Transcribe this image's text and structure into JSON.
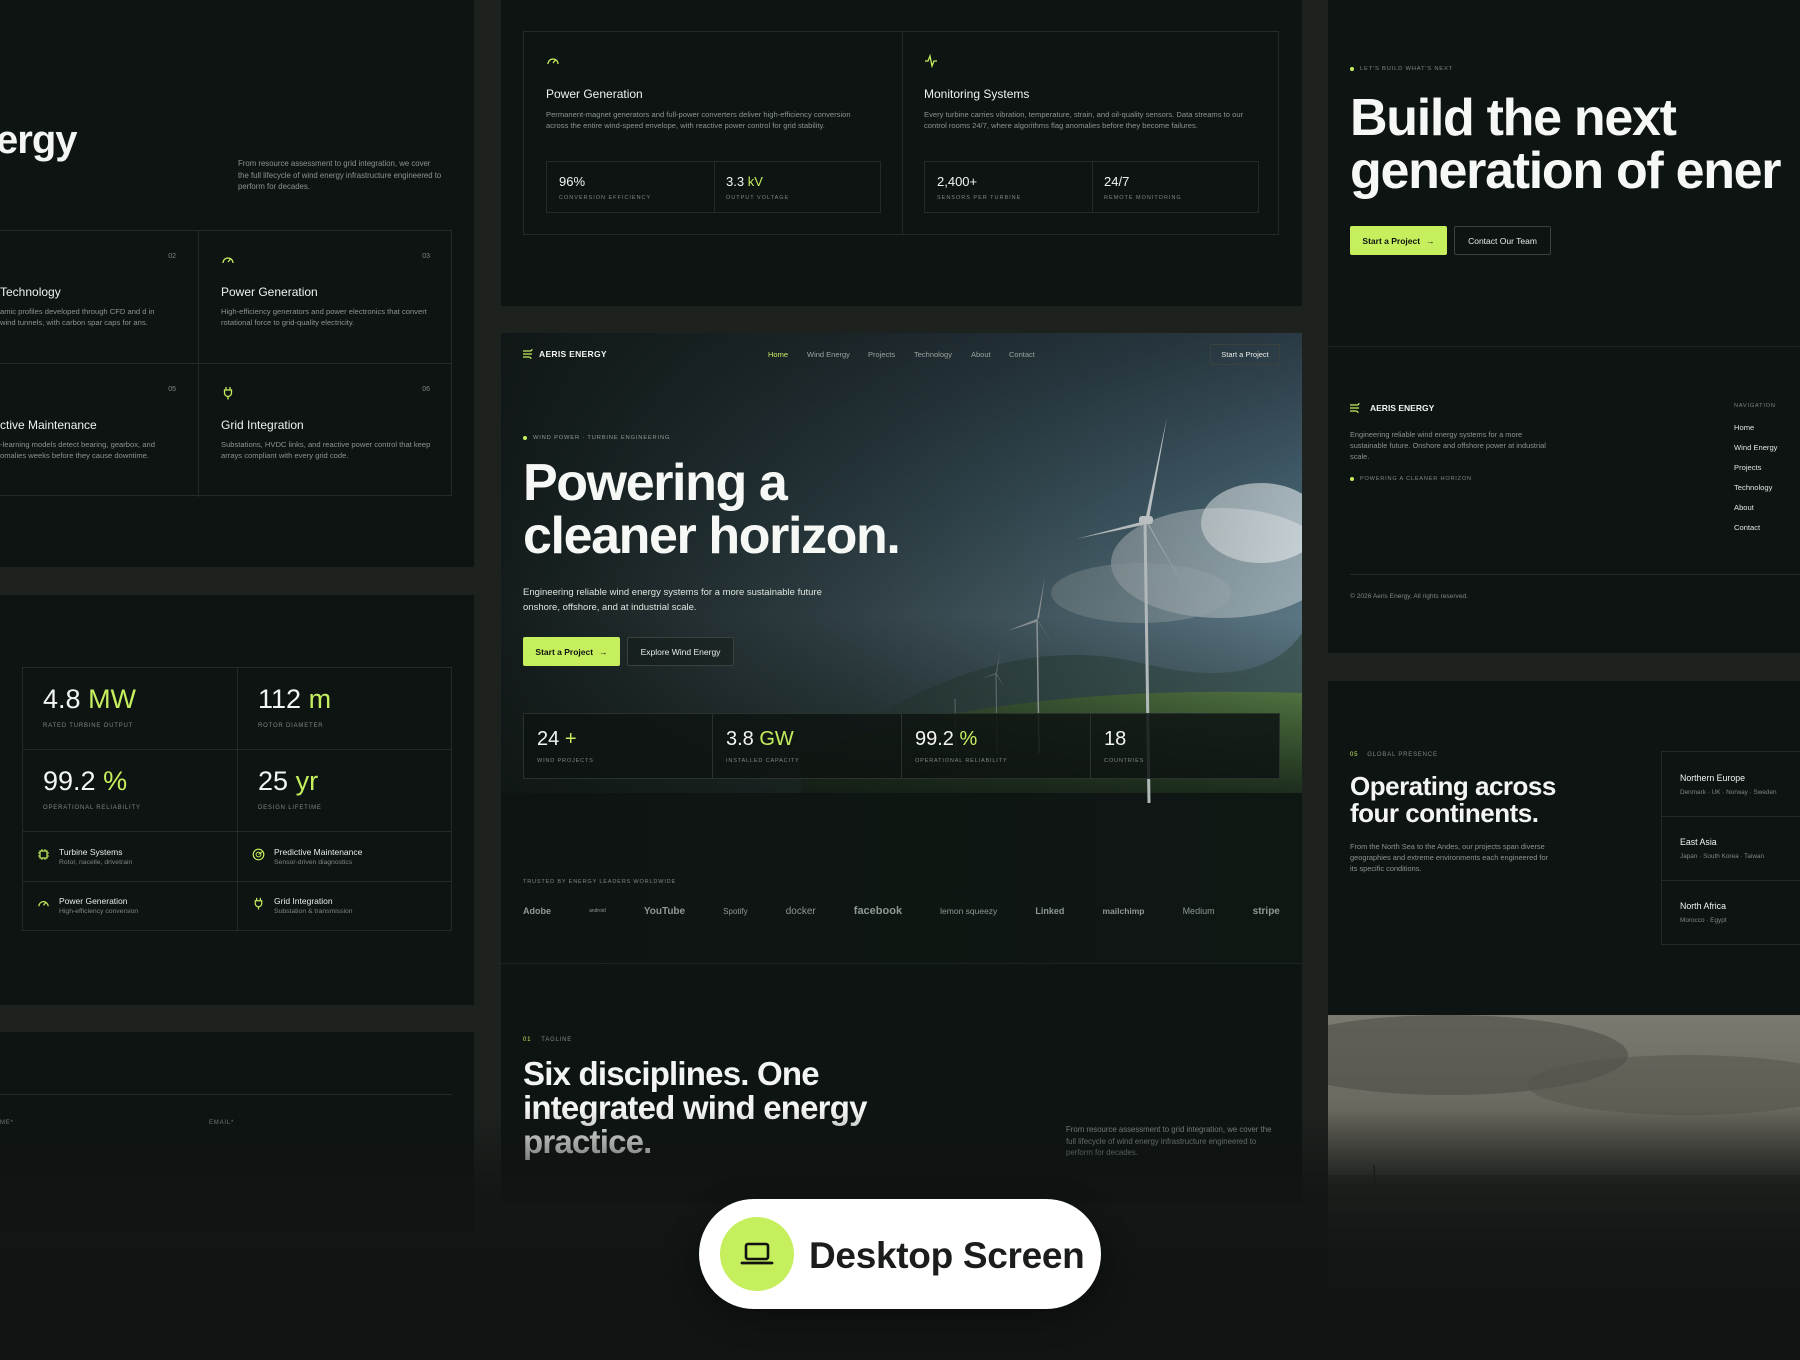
{
  "left_top": {
    "heading_fragment": "ergy",
    "intro": "From resource assessment to grid integration, we cover the full lifecycle of wind energy infrastructure engineered to perform for decades.",
    "cards": [
      {
        "num": "02",
        "title": "Technology",
        "desc": "amic profiles developed through CFD and d in wind tunnels, with carbon spar caps for ans."
      },
      {
        "num": "03",
        "title": "Power Generation",
        "desc": "High-efficiency generators and power electronics that convert rotational force to grid-quality electricity.",
        "icon": "gauge-icon"
      },
      {
        "num": "05",
        "title": "ctive Maintenance",
        "desc": "-learning models detect bearing, gearbox, and omalies weeks before they cause downtime."
      },
      {
        "num": "06",
        "title": "Grid Integration",
        "desc": "Substations, HVDC links, and reactive power control that keep arrays compliant with every grid code.",
        "icon": "plug-icon"
      }
    ]
  },
  "left_mid": {
    "stats": [
      {
        "value": "4.8",
        "unit": "MW",
        "label": "RATED TURBINE OUTPUT"
      },
      {
        "value": "112",
        "unit": "m",
        "label": "ROTOR DIAMETER"
      },
      {
        "value": "99.2",
        "unit": "%",
        "label": "OPERATIONAL RELIABILITY"
      },
      {
        "value": "25",
        "unit": "yr",
        "label": "DESIGN LIFETIME"
      }
    ],
    "features": [
      {
        "title": "Turbine Systems",
        "sub": "Rotor, nacelle, drivetrain",
        "icon": "chip-icon"
      },
      {
        "title": "Predictive Maintenance",
        "sub": "Sensor-driven diagnostics",
        "icon": "radar-icon"
      },
      {
        "title": "Power Generation",
        "sub": "High-efficiency conversion",
        "icon": "gauge-icon"
      },
      {
        "title": "Grid Integration",
        "sub": "Substation & transmission",
        "icon": "plug-icon"
      }
    ]
  },
  "left_bottom": {
    "name_label": "ME*",
    "email_label": "EMAIL*"
  },
  "center_top": {
    "columns": [
      {
        "title": "Power Generation",
        "icon": "gauge-icon",
        "desc": "Permanent-magnet generators and full-power converters deliver high-efficiency conversion across the entire wind-speed envelope, with reactive power control for grid stability.",
        "stats": [
          {
            "value": "96%",
            "unit": "",
            "label": "CONVERSION EFFICIENCY"
          },
          {
            "value": "3.3",
            "unit": "kV",
            "label": "OUTPUT VOLTAGE"
          }
        ]
      },
      {
        "title": "Monitoring Systems",
        "icon": "pulse-icon",
        "desc": "Every turbine carries vibration, temperature, strain, and oil-quality sensors. Data streams to our control rooms 24/7, where algorithms flag anomalies before they become failures.",
        "stats": [
          {
            "value": "2,400+",
            "unit": "",
            "label": "SENSORS PER TURBINE"
          },
          {
            "value": "24/7",
            "unit": "",
            "label": "REMOTE MONITORING"
          }
        ]
      }
    ]
  },
  "hero": {
    "brand": "AERIS ENERGY",
    "nav": [
      "Home",
      "Wind Energy",
      "Projects",
      "Technology",
      "About",
      "Contact"
    ],
    "nav_cta": "Start a Project",
    "eyebrow": "WIND POWER · TURBINE ENGINEERING",
    "title_line1": "Powering a",
    "title_line2": "cleaner horizon.",
    "subtitle": "Engineering reliable wind energy systems for a more sustainable future onshore, offshore, and at industrial scale.",
    "cta_primary": "Start a Project",
    "cta_secondary": "Explore Wind Energy",
    "stats": [
      {
        "value": "24",
        "unit": "+",
        "label": "WIND PROJECTS"
      },
      {
        "value": "3.8",
        "unit": "GW",
        "label": "INSTALLED CAPACITY"
      },
      {
        "value": "99.2",
        "unit": "%",
        "label": "OPERATIONAL RELIABILITY"
      },
      {
        "value": "18",
        "unit": "",
        "label": "COUNTRIES"
      }
    ],
    "trusted_label": "TRUSTED BY ENERGY LEADERS WORLDWIDE",
    "logos": [
      "Adobe",
      "android",
      "YouTube",
      "Spotify",
      "docker",
      "facebook",
      "lemon squeezy",
      "Linked",
      "mailchimp",
      "Medium",
      "stripe"
    ]
  },
  "center_bottom": {
    "num": "01",
    "eyebrow": "TAGLINE",
    "title_line1": "Six disciplines. One",
    "title_line2": "integrated wind energy",
    "title_line3": "practice.",
    "intro": "From resource assessment to grid integration, we cover the full lifecycle of wind energy infrastructure engineered to perform for decades."
  },
  "right_top": {
    "eyebrow": "LET'S BUILD WHAT'S NEXT",
    "title_line1": "Build the next",
    "title_line2": "generation of ener",
    "cta_primary": "Start a Project",
    "cta_secondary": "Contact Our Team"
  },
  "footer": {
    "brand": "AERIS ENERGY",
    "desc": "Engineering reliable wind energy systems for a more sustainable future. Onshore and offshore power at industrial scale.",
    "tag": "POWERING A CLEANER HORIZON",
    "nav_label": "NAVIGATION",
    "nav": [
      "Home",
      "Wind Energy",
      "Projects",
      "Technology",
      "About",
      "Contact"
    ],
    "copyright": "© 2026 Aeris Energy. All rights reserved."
  },
  "presence": {
    "num": "05",
    "eyebrow": "GLOBAL PRESENCE",
    "title_line1": "Operating across",
    "title_line2": "four continents.",
    "desc": "From the North Sea to the Andes, our projects span diverse geographies and extreme environments each engineered for its specific conditions.",
    "regions": [
      {
        "name": "Northern Europe",
        "countries": "Denmark · UK · Norway · Sweden"
      },
      {
        "name": "East Asia",
        "countries": "Japan · South Korea · Taiwan"
      },
      {
        "name": "North Africa",
        "countries": "Morocco · Egypt"
      }
    ]
  },
  "badge": {
    "label": "Desktop Screen",
    "icon": "laptop-icon"
  },
  "colors": {
    "accent": "#c6ef5e",
    "panel": "#0e1412",
    "background": "#1e221f"
  }
}
